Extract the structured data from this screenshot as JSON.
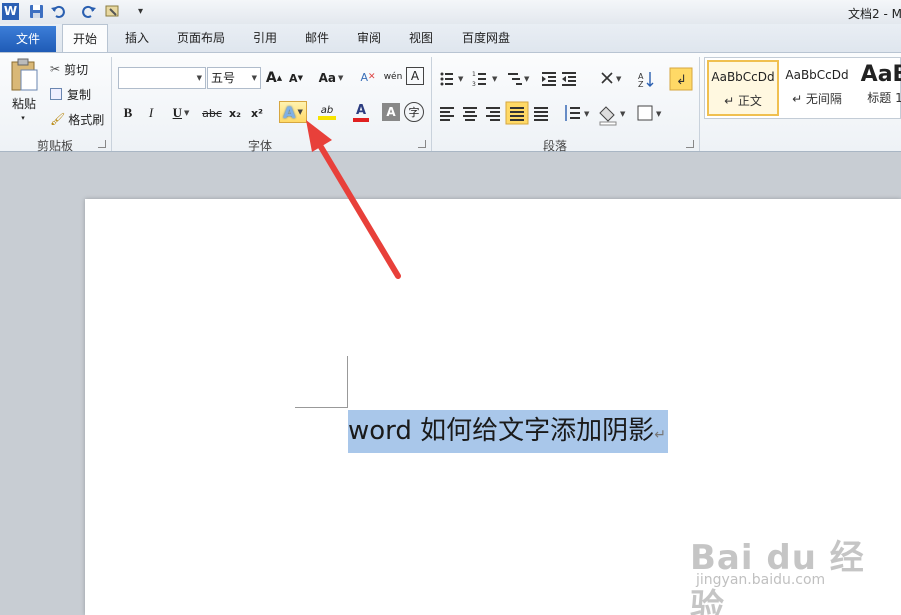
{
  "title_bar": {
    "doc_title": "文档2 - M",
    "qat_more": "▾"
  },
  "tabs": [
    {
      "label": "文件"
    },
    {
      "label": "开始"
    },
    {
      "label": "插入"
    },
    {
      "label": "页面布局"
    },
    {
      "label": "引用"
    },
    {
      "label": "邮件"
    },
    {
      "label": "审阅"
    },
    {
      "label": "视图"
    },
    {
      "label": "百度网盘"
    }
  ],
  "clipboard": {
    "paste": "粘贴",
    "cut": "剪切",
    "copy": "复制",
    "format_painter": "格式刷",
    "group_label": "剪贴板"
  },
  "font": {
    "font_name_value": "",
    "font_size_value": "五号",
    "grow": "A",
    "shrink": "A",
    "change_case": "Aa",
    "clear_format": "A",
    "pinyin": "wén",
    "border": "A",
    "bold": "B",
    "italic": "I",
    "underline": "U",
    "strike": "abc",
    "subscript": "x₂",
    "superscript": "x²",
    "text_effect": "A",
    "highlight": "ab",
    "font_color": "A",
    "char_shading": "A",
    "enclose": "字",
    "group_label": "字体"
  },
  "paragraph": {
    "group_label": "段落"
  },
  "styles": [
    {
      "sample": "AaBbCcDd",
      "name": "↵ 正文"
    },
    {
      "sample": "AaBbCcDd",
      "name": "↵ 无间隔"
    },
    {
      "sample": "AaB",
      "name": "标题 1"
    }
  ],
  "document": {
    "text": "word 如何给文字添加阴影",
    "para_mark": "↵"
  },
  "watermark": {
    "brand": "Bai du 经验",
    "url": "jingyan.baidu.com"
  },
  "colors": {
    "accent": "#2b64c0",
    "selection": "#a9c7ea",
    "arrow": "#e8403a",
    "highlight_yellow": "#f7e300",
    "font_red": "#e02020"
  }
}
